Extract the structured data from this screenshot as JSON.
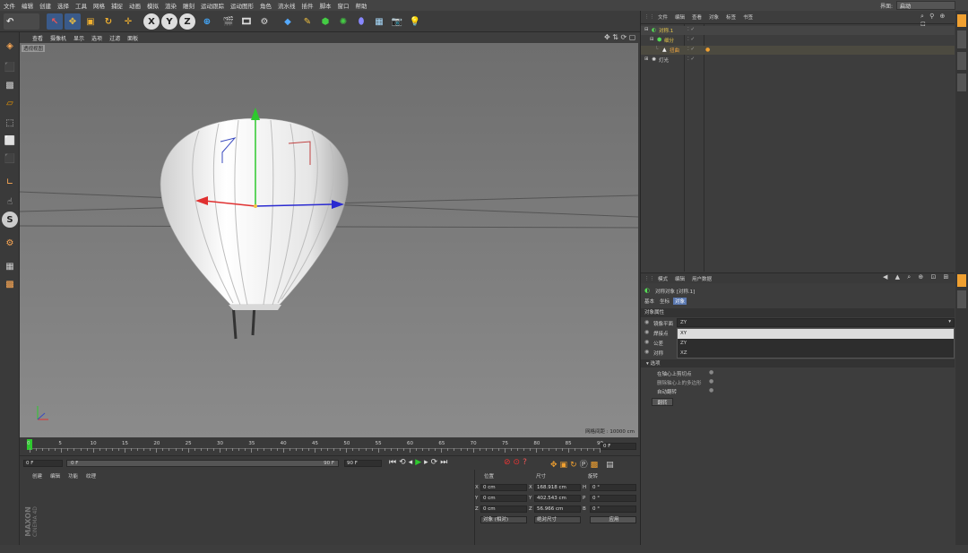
{
  "menu": [
    "文件",
    "编辑",
    "创建",
    "选择",
    "工具",
    "网格",
    "捕捉",
    "动画",
    "模拟",
    "渲染",
    "雕刻",
    "运动跟踪",
    "运动图形",
    "角色",
    "流水线",
    "插件",
    "脚本",
    "窗口",
    "帮助"
  ],
  "layout": {
    "label": "界面:",
    "value": "启动"
  },
  "toolbar": {
    "x": "X",
    "y": "Y",
    "z": "Z"
  },
  "left_tools": {
    "s_label": "S"
  },
  "viewport": {
    "menu": [
      "查看",
      "摄像机",
      "显示",
      "选项",
      "过滤",
      "面板"
    ],
    "camera_tag": "透视视图",
    "grid_info": "网格间距 : 10000 cm"
  },
  "timeline": {
    "ticks": [
      "0",
      "5",
      "10",
      "15",
      "20",
      "25",
      "30",
      "35",
      "40",
      "45",
      "50",
      "55",
      "60",
      "65",
      "70",
      "75",
      "80",
      "85",
      "90"
    ],
    "current_frame": "0 F"
  },
  "transport": {
    "start": "0 F",
    "range_start": "0 F",
    "range_end": "90 F",
    "end": "90 F"
  },
  "object_panel": {
    "menu": [
      "创建",
      "编辑",
      "功能",
      "纹理"
    ]
  },
  "brand": {
    "line1": "MAXON",
    "line2": "CINEMA 4D"
  },
  "coords": {
    "headers": [
      "位置",
      "尺寸",
      "旋转"
    ],
    "rows": [
      {
        "axis": "X",
        "pos": "0 cm",
        "size_axis": "X",
        "size": "168.918 cm",
        "rot_axis": "H",
        "rot": "0 °"
      },
      {
        "axis": "Y",
        "pos": "0 cm",
        "size_axis": "Y",
        "size": "402.543 cm",
        "rot_axis": "P",
        "rot": "0 °"
      },
      {
        "axis": "Z",
        "pos": "0 cm",
        "size_axis": "Z",
        "size": "56.966 cm",
        "rot_axis": "B",
        "rot": "0 °"
      }
    ],
    "mode": "对象 (相对)",
    "size_mode": "绝对尺寸",
    "apply": "应用"
  },
  "object_manager": {
    "menu": [
      "文件",
      "编辑",
      "查看",
      "对象",
      "标签",
      "书签"
    ],
    "items": [
      {
        "name": "对称.1",
        "color": "#e8c84a"
      },
      {
        "name": "细分",
        "color": "#e8c84a"
      },
      {
        "name": "扭曲",
        "color": "#e8a040"
      },
      {
        "name": "灯光",
        "color": "#cccccc"
      }
    ]
  },
  "attributes": {
    "menu": [
      "模式",
      "编辑",
      "用户数据"
    ],
    "title": "对称对象 [对称.1]",
    "tabs": [
      "基本",
      "坐标",
      "对象"
    ],
    "section": "对象属性",
    "mirror_plane_label": "镜像平面",
    "mirror_plane_value": "ZY",
    "dropdown_options": [
      "XY",
      "ZY",
      "XZ"
    ],
    "props": [
      "焊接点",
      "公差",
      "对称"
    ],
    "subsection": "▾ 选项",
    "options": [
      "在轴心上剪切点",
      "删除轴心上的多边形",
      "自动翻转"
    ],
    "flip_button": "翻转"
  },
  "colors": {
    "accent": "#f0a030",
    "selection": "#5a78b0"
  }
}
